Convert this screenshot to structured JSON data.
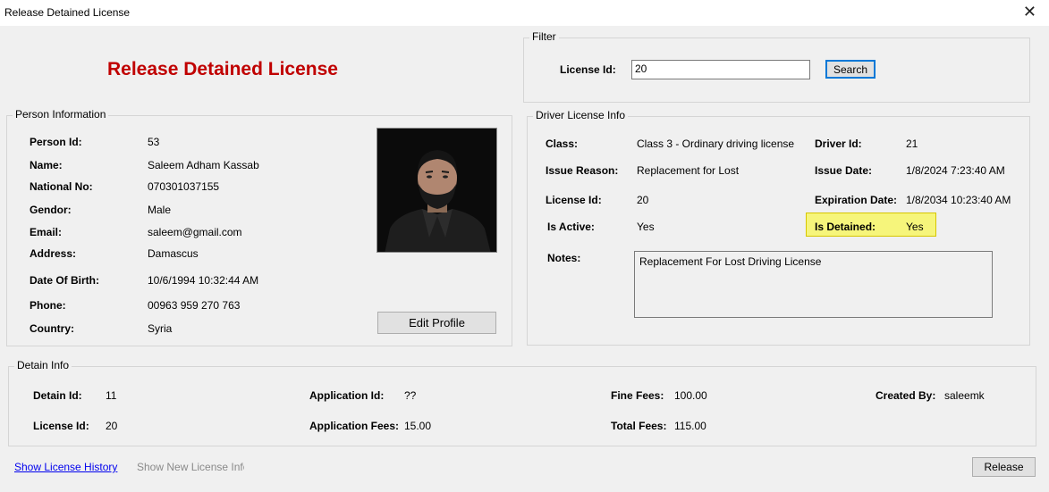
{
  "window": {
    "title": "Release Detained License",
    "close_glyph": "✕"
  },
  "heading": "Release Detained License",
  "filter": {
    "group_title": "Filter",
    "license_id_label": "License Id:",
    "license_id_value": "20",
    "search_label": "Search"
  },
  "person": {
    "group_title": "Person Information",
    "fields": [
      {
        "label": "Person Id:",
        "value": "53"
      },
      {
        "label": "Name:",
        "value": "Saleem Adham Kassab"
      },
      {
        "label": "National No:",
        "value": "070301037155"
      },
      {
        "label": "Gendor:",
        "value": "Male"
      },
      {
        "label": "Email:",
        "value": "saleem@gmail.com"
      },
      {
        "label": "Address:",
        "value": "Damascus"
      },
      {
        "label": "Date Of Birth:",
        "value": "10/6/1994 10:32:44 AM"
      },
      {
        "label": "Phone:",
        "value": "00963 959 270 763"
      },
      {
        "label": "Country:",
        "value": "Syria"
      }
    ],
    "edit_profile_label": "Edit Profile"
  },
  "license": {
    "group_title": "Driver License Info",
    "class_label": "Class:",
    "class_value": "Class 3 - Ordinary driving license",
    "issue_reason_label": "Issue Reason:",
    "issue_reason_value": "Replacement for Lost",
    "license_id_label": "License Id:",
    "license_id_value": "20",
    "is_active_label": "Is Active:",
    "is_active_value": "Yes",
    "notes_label": "Notes:",
    "notes_value": "Replacement For Lost Driving License",
    "driver_id_label": "Driver Id:",
    "driver_id_value": "21",
    "issue_date_label": "Issue Date:",
    "issue_date_value": "1/8/2024 7:23:40 AM",
    "expiration_date_label": "Expiration Date:",
    "expiration_date_value": "1/8/2034 10:23:40 AM",
    "is_detained_label": "Is Detained:",
    "is_detained_value": "Yes",
    "highlight_color": "#f6f57b"
  },
  "detain": {
    "group_title": "Detain Info",
    "detain_id_label": "Detain Id:",
    "detain_id_value": "11",
    "license_id_label": "License Id:",
    "license_id_value": "20",
    "application_id_label": "Application Id:",
    "application_id_value": "??",
    "application_fees_label": "Application Fees:",
    "application_fees_value": "15.00",
    "fine_fees_label": "Fine Fees:",
    "fine_fees_value": "100.00",
    "total_fees_label": "Total Fees:",
    "total_fees_value": "115.00",
    "created_by_label": "Created By:",
    "created_by_value": "saleemk"
  },
  "footer": {
    "show_history_label": "Show License History",
    "show_new_license_label": "Show New License Info",
    "release_label": "Release"
  },
  "colors": {
    "heading": "#c00000",
    "link": "#0000ee",
    "focus": "#0078d7"
  }
}
